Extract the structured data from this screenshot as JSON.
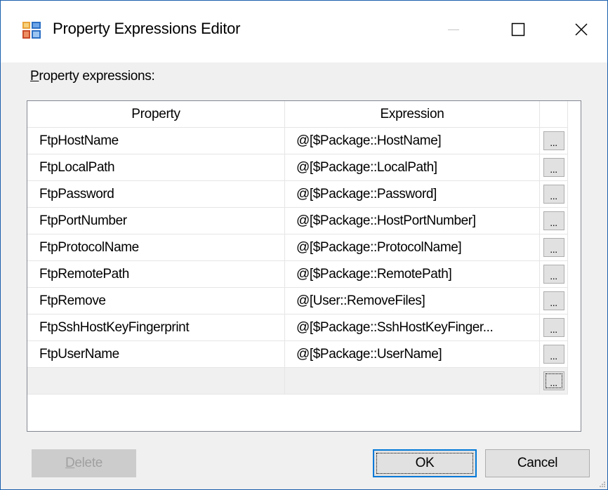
{
  "window": {
    "title": "Property Expressions Editor",
    "icon": "property-expressions-app-icon",
    "accent_color": "#1b5fae"
  },
  "section_label": {
    "access_key": "P",
    "rest": "roperty expressions:"
  },
  "grid": {
    "columns": {
      "property": "Property",
      "expression": "Expression"
    },
    "ellipsis_label": "...",
    "rows": [
      {
        "property": "FtpHostName",
        "expression": "@[$Package::HostName]"
      },
      {
        "property": "FtpLocalPath",
        "expression": "@[$Package::LocalPath]"
      },
      {
        "property": "FtpPassword",
        "expression": "@[$Package::Password]"
      },
      {
        "property": "FtpPortNumber",
        "expression": "@[$Package::HostPortNumber]"
      },
      {
        "property": "FtpProtocolName",
        "expression": "@[$Package::ProtocolName]"
      },
      {
        "property": "FtpRemotePath",
        "expression": "@[$Package::RemotePath]"
      },
      {
        "property": "FtpRemove",
        "expression": "@[User::RemoveFiles]"
      },
      {
        "property": "FtpSshHostKeyFingerprint",
        "expression": "@[$Package::SshHostKeyFinger..."
      },
      {
        "property": "FtpUserName",
        "expression": "@[$Package::UserName]"
      }
    ]
  },
  "buttons": {
    "delete_access_key": "D",
    "delete_rest": "elete",
    "ok": "OK",
    "cancel": "Cancel"
  }
}
